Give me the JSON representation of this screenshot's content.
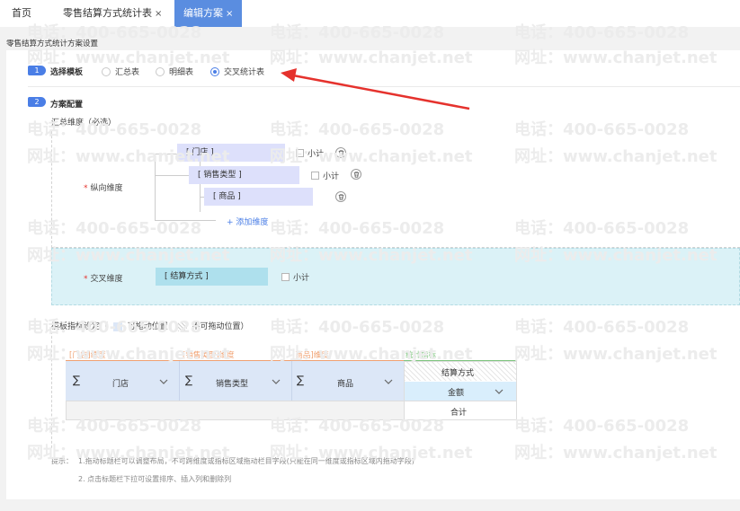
{
  "tabs": [
    {
      "label": "首页",
      "closable": false,
      "active": false
    },
    {
      "label": "零售结算方式统计表",
      "closable": true,
      "active": false
    },
    {
      "label": "编辑方案",
      "closable": true,
      "active": true
    }
  ],
  "close_glyph": "×",
  "page_title": "零售结算方式统计方案设置",
  "watermark": {
    "phone": "电话：400-665-0028",
    "site": "网址：www.chanjet.net"
  },
  "step1": {
    "number": "1",
    "title": "选择模板",
    "options": [
      "汇总表",
      "明细表",
      "交叉统计表"
    ],
    "selected": "交叉统计表"
  },
  "step2": {
    "number": "2",
    "title": "方案配置",
    "summary_label": "汇总维度（必选）",
    "vertical_label": "纵向维度",
    "vertical_dims": [
      "[ 门店 ]",
      "[ 销售类型 ]",
      "[ 商品 ]"
    ],
    "subtotal_label": "小计",
    "add_dim_label": "+ 添加维度",
    "cross_label": "交叉维度",
    "cross_dim": "[ 结算方式 ]"
  },
  "indicator": {
    "title_prefix": "模板指标设定（",
    "draggable": "可拖动位置",
    "fixed": "不可拖动位置）",
    "groups": [
      {
        "label": "[门店]维度",
        "color": "#f0a070"
      },
      {
        "label": "[销售类型]维度",
        "color": "#f0a070"
      },
      {
        "label": "[商品]维度",
        "color": "#f0a070"
      },
      {
        "label": "统计指标",
        "color": "#7dc47d"
      }
    ],
    "columns": [
      "门店",
      "销售类型",
      "商品"
    ],
    "sigma": "∑",
    "cross_header": "结算方式",
    "amount": "金额",
    "total": "合计"
  },
  "hints": {
    "prefix": "提示：",
    "line1": "1.拖动标题栏可以调整布局，不可跨维度或指标区域拖动栏目字段(只能在同一维度或指标区域内拖动字段)",
    "line2": "2. 点击标题栏下拉可设置排序、插入列和删除列"
  },
  "colors": {
    "accent": "#4a7ee6",
    "active_tab": "#5a8de0",
    "dim_box": "#dde0fb",
    "cross_area": "#dbf2f7",
    "arrow": "#e5322d"
  }
}
